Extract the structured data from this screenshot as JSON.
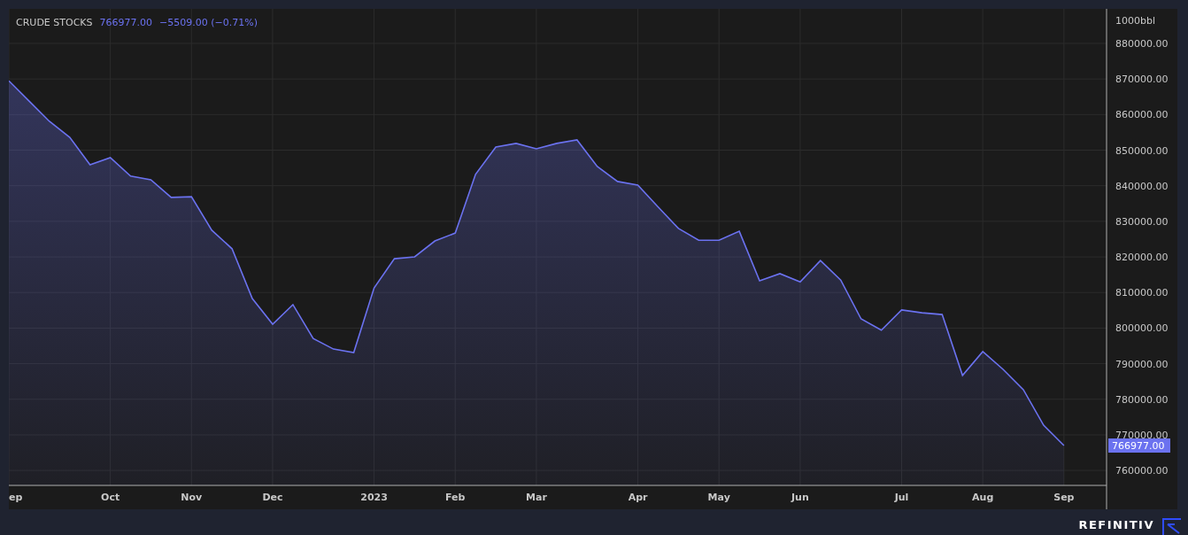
{
  "header": {
    "last": "766977.00",
    "change": "−5509.00 (−0.71%)"
  },
  "chart_data": {
    "type": "area",
    "grid": true,
    "ylabel": "1000bbl",
    "categories": [
      "ep",
      null,
      null,
      null,
      null,
      "Oct",
      null,
      null,
      null,
      "Nov",
      null,
      null,
      null,
      "Dec",
      null,
      null,
      null,
      null,
      "2023",
      null,
      null,
      null,
      "Feb",
      null,
      null,
      null,
      "Mar",
      null,
      null,
      null,
      null,
      "Apr",
      null,
      null,
      null,
      "May",
      null,
      null,
      null,
      "Jun",
      null,
      null,
      null,
      null,
      "Jul",
      null,
      null,
      null,
      "Aug",
      null,
      null,
      null,
      "Sep"
    ],
    "series": [
      {
        "name": "CRUDE STOCKS",
        "color": "#6b72f0",
        "values": [
          869500,
          863800,
          858100,
          853600,
          845900,
          847900,
          842700,
          841700,
          836700,
          836900,
          827500,
          822300,
          808300,
          801100,
          806600,
          797100,
          794100,
          793100,
          811300,
          819500,
          820000,
          824500,
          826700,
          843200,
          850900,
          851900,
          850400,
          851900,
          852900,
          845400,
          841200,
          840200,
          834000,
          828000,
          824700,
          824700,
          827200,
          813300,
          815300,
          813000,
          819000,
          813500,
          802600,
          799400,
          805100,
          804300,
          803800,
          786700,
          793400,
          788400,
          782700,
          772700,
          767000
        ]
      }
    ],
    "ylim": [
      755800,
      889700
    ],
    "yticks": [
      {
        "value": 760000,
        "label": "760000.00"
      },
      {
        "value": 770000,
        "label": "770000.00"
      },
      {
        "value": 780000,
        "label": "780000.00"
      },
      {
        "value": 790000,
        "label": "790000.00"
      },
      {
        "value": 800000,
        "label": "800000.00"
      },
      {
        "value": 810000,
        "label": "810000.00"
      },
      {
        "value": 820000,
        "label": "820000.00"
      },
      {
        "value": 830000,
        "label": "830000.00"
      },
      {
        "value": 840000,
        "label": "840000.00"
      },
      {
        "value": 850000,
        "label": "850000.00"
      },
      {
        "value": 860000,
        "label": "860000.00"
      },
      {
        "value": 870000,
        "label": "870000.00"
      },
      {
        "value": 880000,
        "label": "880000.00"
      }
    ],
    "annotations": [
      "766977.00"
    ]
  },
  "footer": {
    "brand": "REFINITIV"
  }
}
